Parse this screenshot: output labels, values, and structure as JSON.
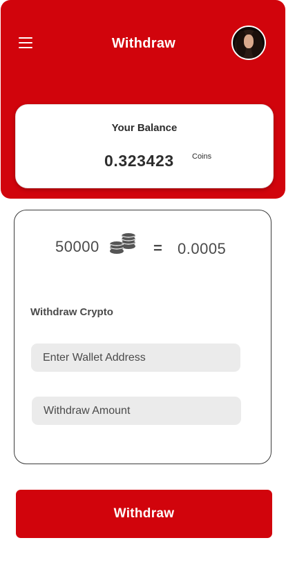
{
  "header": {
    "title": "Withdraw",
    "menu_icon": "hamburger-menu-icon",
    "avatar": "user-avatar"
  },
  "balance": {
    "label": "Your Balance",
    "value": "0.323423",
    "unit": "Coins"
  },
  "rate": {
    "coins": "50000",
    "coin_icon": "coin-stack-icon",
    "equals": "=",
    "crypto": "0.0005"
  },
  "form": {
    "section_label": "Withdraw Crypto",
    "wallet_placeholder": "Enter Wallet Address",
    "amount_placeholder": "Withdraw Amount"
  },
  "action": {
    "submit_label": "Withdraw"
  },
  "colors": {
    "brand_red": "#d1040c",
    "field_bg": "#ebebeb",
    "text_dark": "#2d2d2d"
  }
}
